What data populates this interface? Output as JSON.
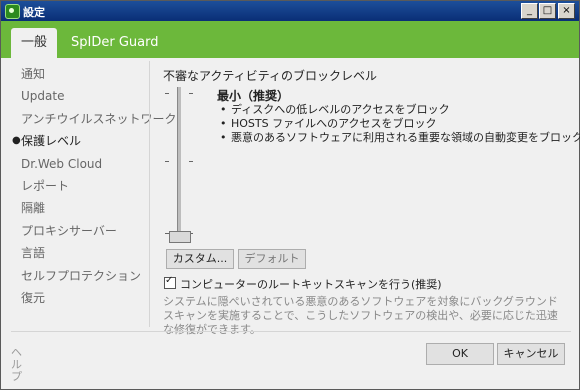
{
  "window": {
    "title": "設定"
  },
  "tabs": [
    "一般",
    "SpIDer Guard"
  ],
  "sidebar": {
    "items": [
      "通知",
      "Update",
      "アンチウイルスネットワーク",
      "保護レベル",
      "Dr.Web Cloud",
      "レポート",
      "隔離",
      "プロキシサーバー",
      "言語",
      "セルフプロテクション",
      "復元"
    ],
    "selected_index": 3
  },
  "help_label": "ヘルプ",
  "protection": {
    "section_title": "不審なアクティビティのブロックレベル",
    "level_title": "最小（推奨）",
    "level_items": [
      "ディスクへの低レベルのアクセスをブロック",
      "HOSTS ファイルへのアクセスをブロック",
      "悪意のあるソフトウェアに利用される重要な領域の自動変更をブロック"
    ],
    "custom_button": "カスタム...",
    "default_button": "デフォルト"
  },
  "rootkit": {
    "checked": true,
    "label": "コンピューターのルートキットスキャンを行う(推奨)",
    "description": "システムに隠ぺいされている悪意のあるソフトウェアを対象にバックグラウンドスキャンを実施することで、こうしたソフトウェアの検出や、必要に応じた迅速な修復ができます。"
  },
  "buttons": {
    "ok": "OK",
    "cancel": "キャンセル"
  }
}
